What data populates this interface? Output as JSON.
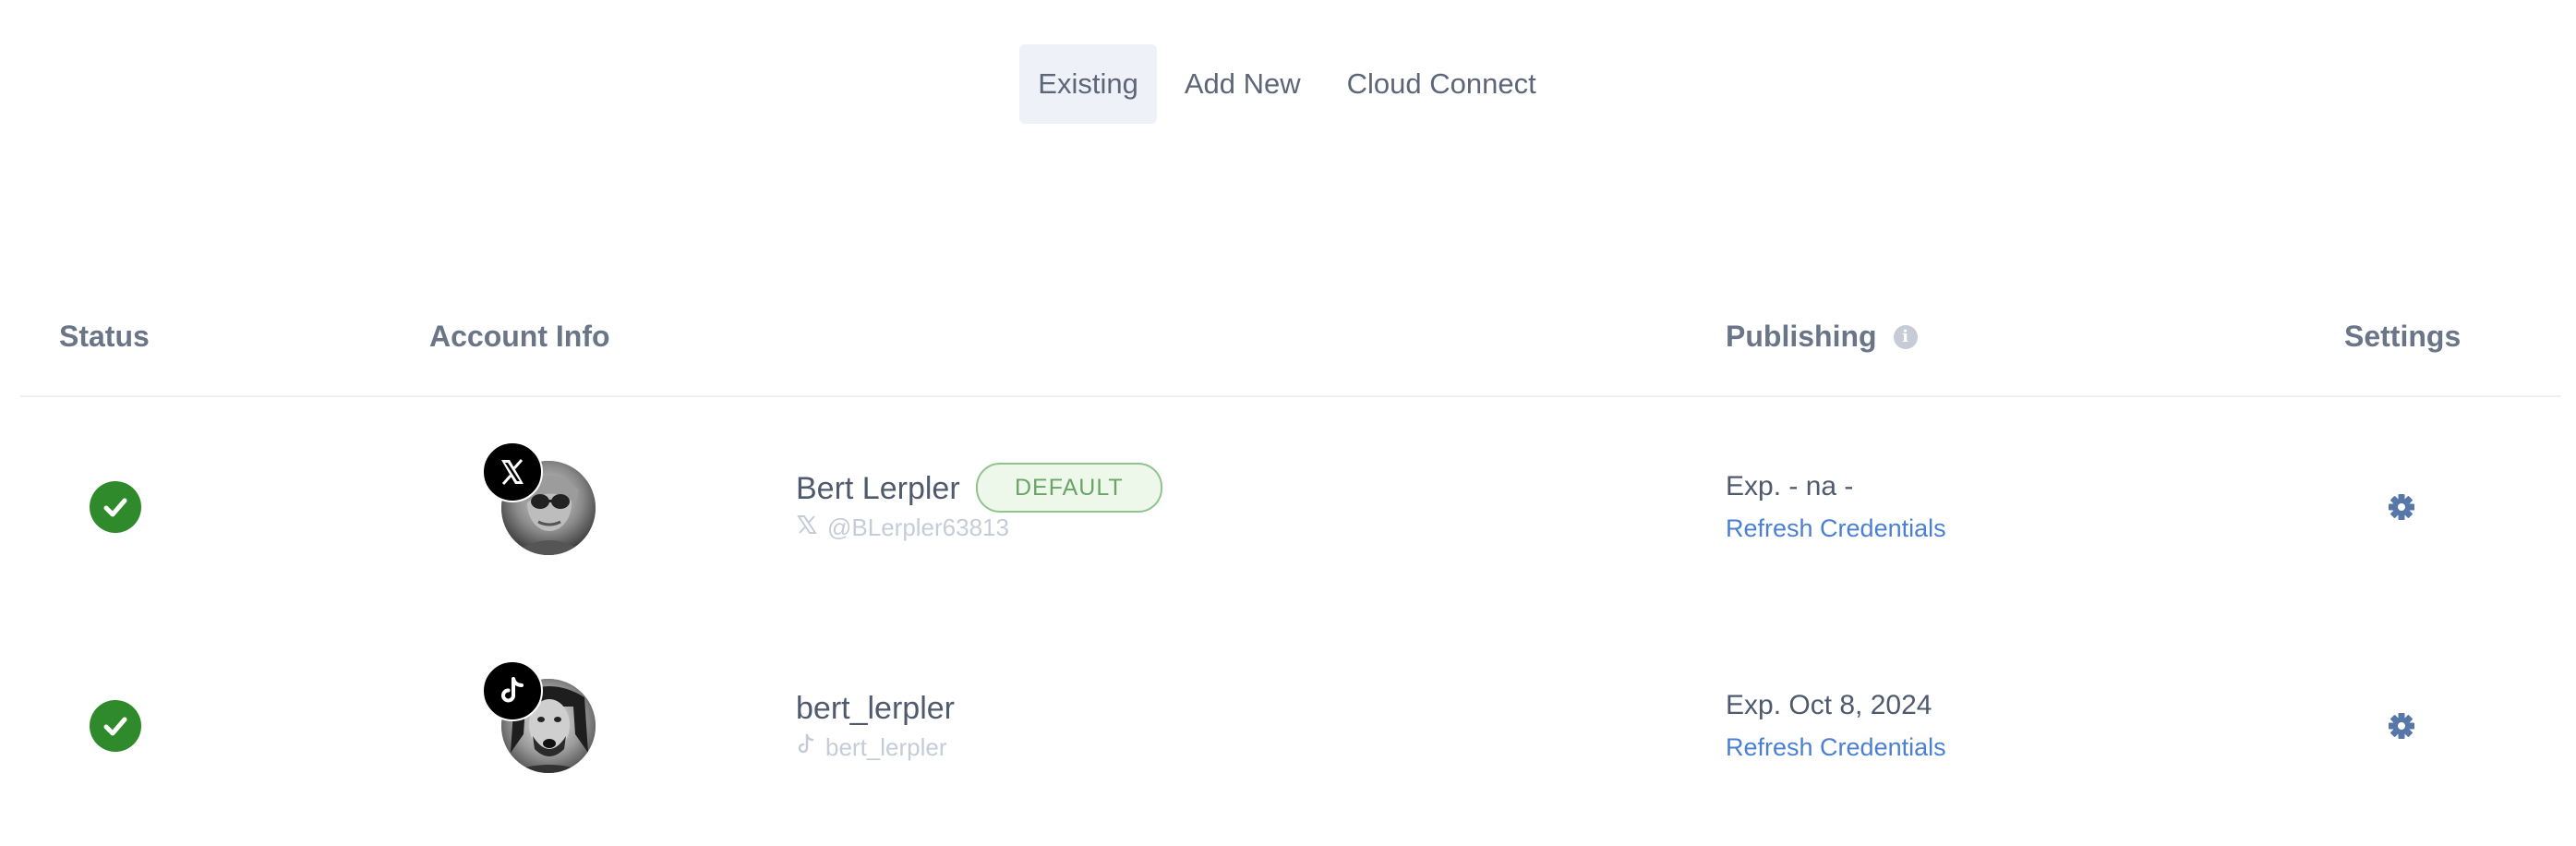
{
  "tabs": [
    {
      "label": "Existing",
      "active": true
    },
    {
      "label": "Add New",
      "active": false
    },
    {
      "label": "Cloud Connect",
      "active": false
    }
  ],
  "table": {
    "headers": {
      "status": "Status",
      "account_info": "Account Info",
      "publishing": "Publishing",
      "settings": "Settings"
    }
  },
  "accounts": [
    {
      "status": "check-icon",
      "platform": "x-icon",
      "name": "Bert Lerpler",
      "badge": "DEFAULT",
      "handle": "@BLerpler63813",
      "expiry": "Exp. - na -",
      "refresh": "Refresh Credentials"
    },
    {
      "status": "check-icon",
      "platform": "tiktok-icon",
      "name": "bert_lerpler",
      "handle": "bert_lerpler",
      "expiry": "Exp. Oct 8, 2024",
      "refresh": "Refresh Credentials"
    }
  ],
  "colors": {
    "success": "#2e8a2a",
    "link": "#4a7fd4",
    "default_badge_bg": "#edf7ea",
    "default_badge_border": "#8fc48a",
    "tab_active_bg": "#eef2f8"
  }
}
